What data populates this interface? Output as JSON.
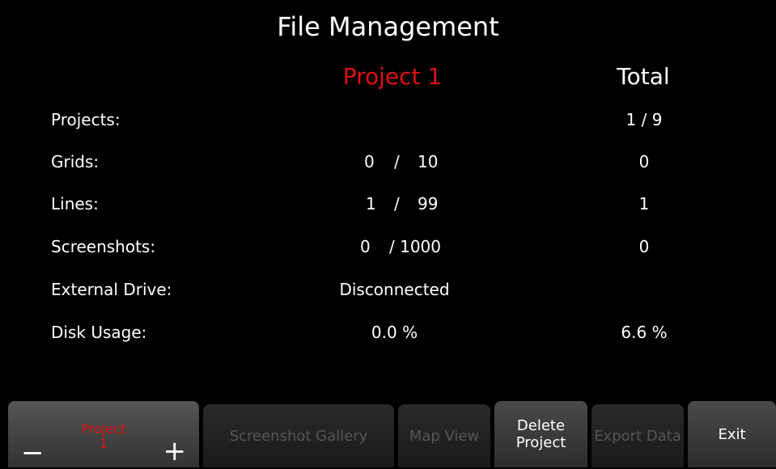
{
  "title": "File Management",
  "columns": {
    "project": "Project 1",
    "total": "Total"
  },
  "rows": [
    {
      "label": "Projects:",
      "project_value": "",
      "total": "1  /  9"
    },
    {
      "label": "Grids:",
      "project_a": "0",
      "project_sep": "/",
      "project_b": "10",
      "total": "0"
    },
    {
      "label": "Lines:",
      "project_a": "1",
      "project_sep": "/",
      "project_b": "99",
      "total": "1"
    },
    {
      "label": "Screenshots:",
      "project_a": "0",
      "project_sep": "/ 1000",
      "total": "0"
    },
    {
      "label": "External Drive:",
      "project_value": "Disconnected",
      "total": ""
    },
    {
      "label": "Disk Usage:",
      "project_value": "0.0 %",
      "total": "6.6 %"
    }
  ],
  "toolbar": {
    "project_selector": {
      "label_line1": "Project",
      "label_line2": "1",
      "minus": "−",
      "plus": "+"
    },
    "screenshot_gallery": "Screenshot Gallery",
    "map_view": "Map View",
    "delete_project_line1": "Delete",
    "delete_project_line2": "Project",
    "export_data": "Export Data",
    "exit": "Exit"
  },
  "colors": {
    "accent": "#e01010",
    "background": "#000000",
    "disabled_text": "#555555"
  }
}
